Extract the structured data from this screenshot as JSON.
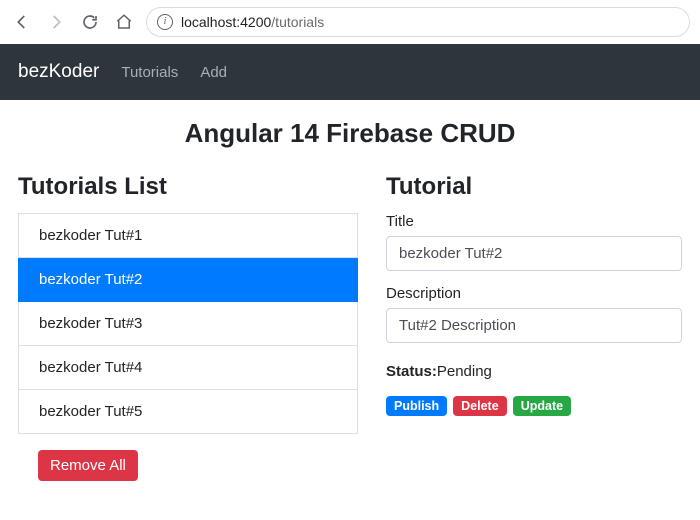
{
  "browser": {
    "url_host": "localhost:4200",
    "url_path": "/tutorials"
  },
  "header": {
    "brand": "bezKoder",
    "links": [
      {
        "label": "Tutorials"
      },
      {
        "label": "Add"
      }
    ]
  },
  "page_title": "Angular 14 Firebase CRUD",
  "left": {
    "title": "Tutorials List",
    "items": [
      {
        "label": "bezkoder Tut#1",
        "active": false
      },
      {
        "label": "bezkoder Tut#2",
        "active": true
      },
      {
        "label": "bezkoder Tut#3",
        "active": false
      },
      {
        "label": "bezkoder Tut#4",
        "active": false
      },
      {
        "label": "bezkoder Tut#5",
        "active": false
      }
    ],
    "remove_all_label": "Remove All"
  },
  "right": {
    "title": "Tutorial",
    "title_label": "Title",
    "title_value": "bezkoder Tut#2",
    "description_label": "Description",
    "description_value": "Tut#2 Description",
    "status_label": "Status:",
    "status_value": "Pending",
    "publish_label": "Publish",
    "delete_label": "Delete",
    "update_label": "Update"
  }
}
